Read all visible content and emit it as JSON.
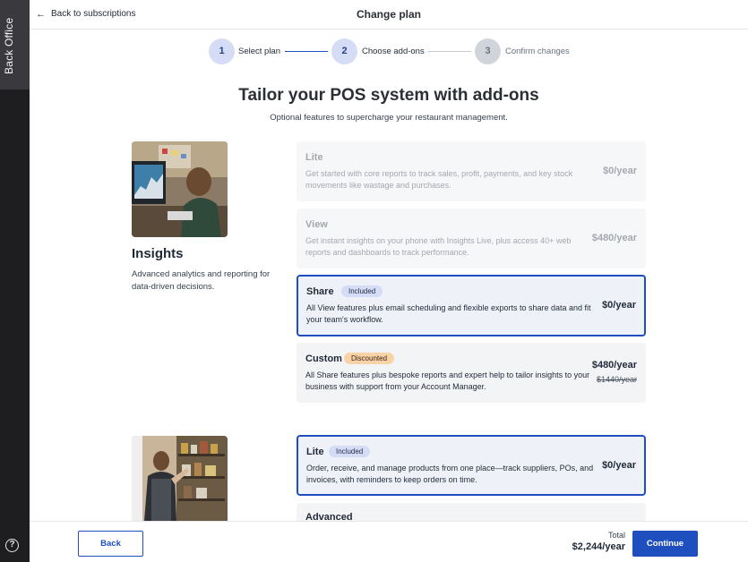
{
  "sidebar": {
    "tab_label": "Back Office",
    "help_glyph": "?"
  },
  "header": {
    "back_label": "Back to subscriptions",
    "title": "Change plan"
  },
  "stepper": {
    "steps": [
      {
        "number": "1",
        "label": "Select plan",
        "state": "complete"
      },
      {
        "number": "2",
        "label": "Choose add-ons",
        "state": "current"
      },
      {
        "number": "3",
        "label": "Confirm changes",
        "state": "upcoming"
      }
    ]
  },
  "main": {
    "headline": "Tailor your POS system with add-ons",
    "subline": "Optional features to supercharge your restaurant management."
  },
  "insights": {
    "title": "Insights",
    "description": "Advanced analytics and reporting for data-driven decisions.",
    "plans": [
      {
        "name": "Lite",
        "description": "Get started with core reports to track sales, profit, payments, and key stock movements like wastage and purchases.",
        "price": "$0/year",
        "state": "disabled"
      },
      {
        "name": "View",
        "description": "Get instant insights on your phone with Insights Live, plus access 40+ web reports and dashboards to track performance.",
        "price": "$480/year",
        "state": "disabled"
      },
      {
        "name": "Share",
        "badge": "Included",
        "description": "All View features plus email scheduling and flexible exports to share data and fit your team's workflow.",
        "price": "$0/year",
        "state": "selected"
      },
      {
        "name": "Custom",
        "badge": "Discounted",
        "description": "All Share features plus bespoke reports and expert help to tailor insights to your business with support from your Account Manager.",
        "price": "$480/year",
        "old_price": "$1440/year",
        "state": "default"
      }
    ]
  },
  "inventory": {
    "plans": [
      {
        "name": "Lite",
        "badge": "Included",
        "description": "Order, receive, and manage products from one place—track suppliers, POs, and invoices, with reminders to keep orders on time.",
        "price": "$0/year",
        "state": "selected"
      },
      {
        "name": "Advanced",
        "state": "default"
      }
    ]
  },
  "footer": {
    "back_label": "Back",
    "total_label": "Total",
    "total_value": "$2,244/year",
    "continue_label": "Continue"
  },
  "colors": {
    "accent": "#1f4fbf",
    "badge_included": "#d4dcf6",
    "badge_discounted": "#f9d3a8",
    "rail": "#1e1e20"
  },
  "icons": {
    "back": "arrow-left-icon",
    "help": "help-circle-icon"
  }
}
